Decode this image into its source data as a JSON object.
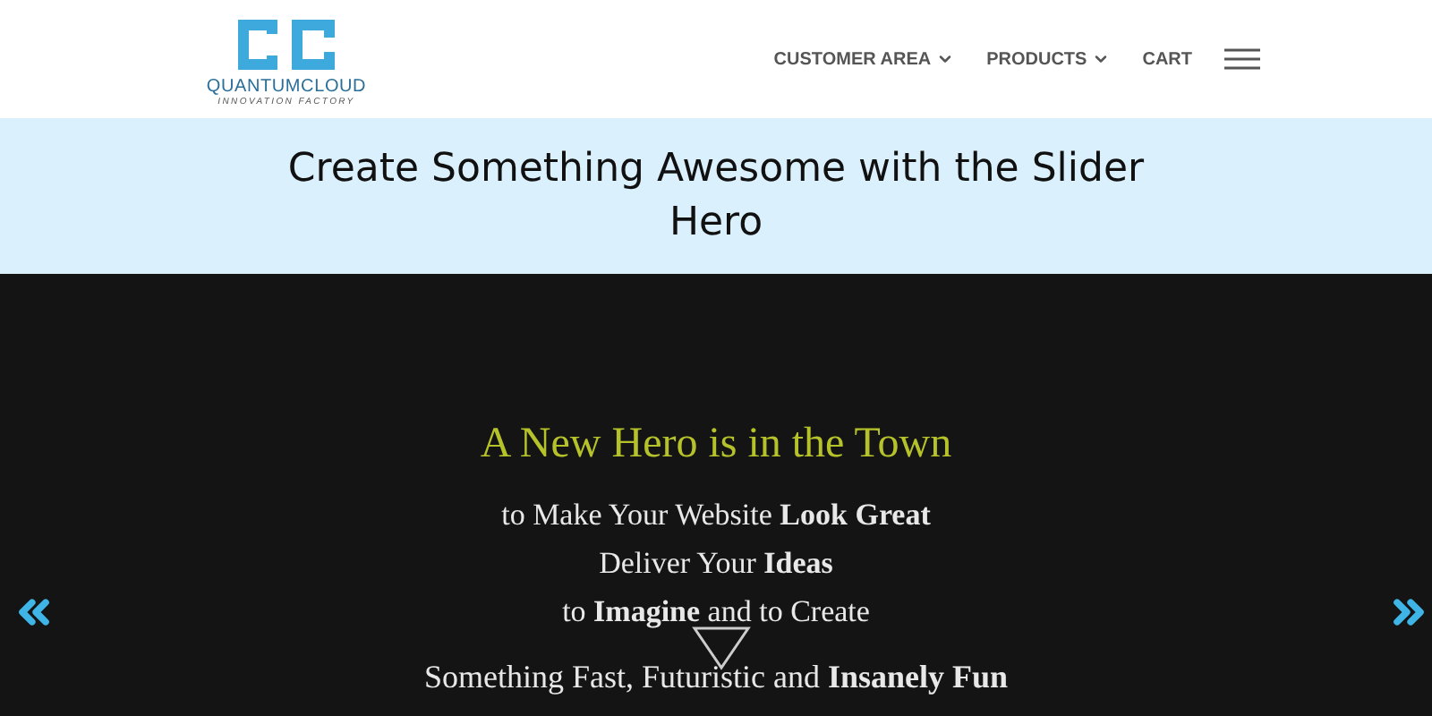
{
  "logo": {
    "name": "QUANTUMCLOUD",
    "tagline": "INNOVATION FACTORY"
  },
  "nav": [
    {
      "label": "CUSTOMER AREA",
      "dropdown": true
    },
    {
      "label": "PRODUCTS",
      "dropdown": true
    },
    {
      "label": "CART",
      "dropdown": false
    }
  ],
  "banner": {
    "title": "Create Something Awesome with the Slider Hero"
  },
  "hero": {
    "heading": "A New Hero is in the Town",
    "lines": [
      "to Make Your Website **Look Great**",
      "Deliver Your **Ideas**",
      "to **Imagine** and to Create"
    ],
    "tail": "Something Fast, Futuristic and **Insanely Fun**"
  }
}
